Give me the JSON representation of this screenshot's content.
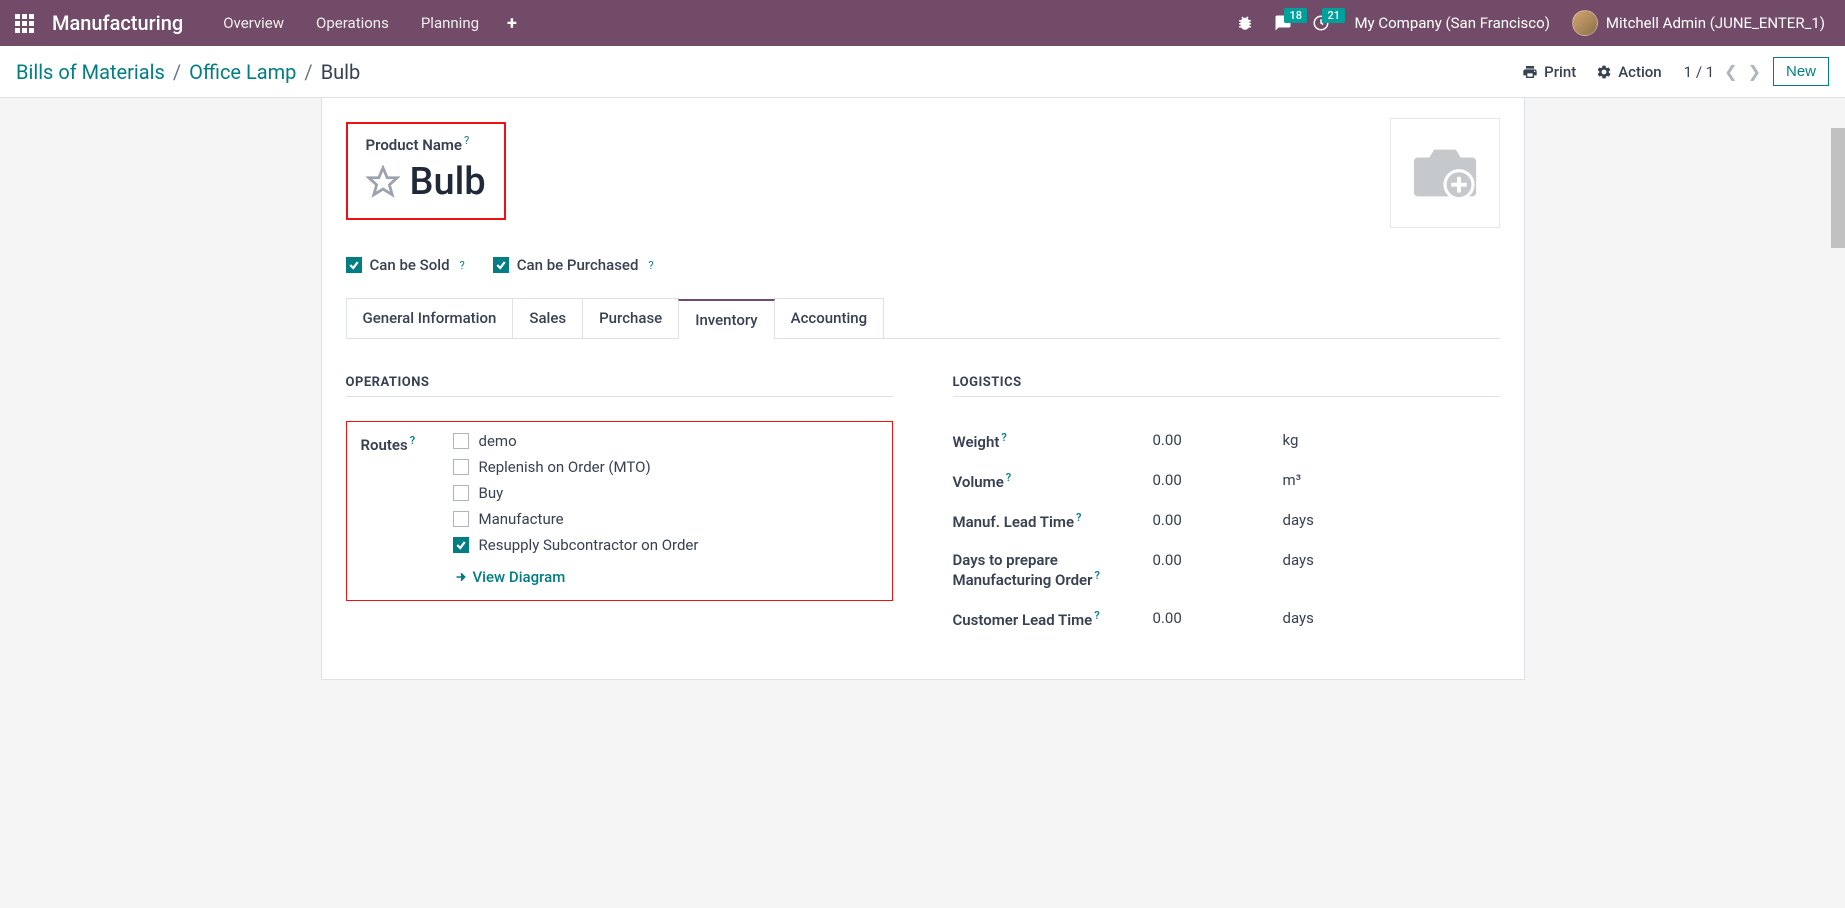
{
  "nav": {
    "brand": "Manufacturing",
    "menu": [
      "Overview",
      "Operations",
      "Planning"
    ],
    "messages_badge": "18",
    "activities_badge": "21",
    "company": "My Company (San Francisco)",
    "user": "Mitchell Admin (JUNE_ENTER_1)"
  },
  "controlbar": {
    "breadcrumb": [
      "Bills of Materials",
      "Office Lamp",
      "Bulb"
    ],
    "print": "Print",
    "action": "Action",
    "pager": "1 / 1",
    "new": "New"
  },
  "form": {
    "title_label": "Product Name",
    "product_name": "Bulb",
    "can_be_sold": "Can be Sold",
    "can_be_purchased": "Can be Purchased",
    "tabs": [
      "General Information",
      "Sales",
      "Purchase",
      "Inventory",
      "Accounting"
    ],
    "active_tab": 3
  },
  "operations": {
    "title": "OPERATIONS",
    "routes_label": "Routes",
    "routes": [
      {
        "label": "demo",
        "checked": false
      },
      {
        "label": "Replenish on Order (MTO)",
        "checked": false
      },
      {
        "label": "Buy",
        "checked": false
      },
      {
        "label": "Manufacture",
        "checked": false
      },
      {
        "label": "Resupply Subcontractor on Order",
        "checked": true
      }
    ],
    "view_diagram": "View Diagram"
  },
  "logistics": {
    "title": "LOGISTICS",
    "rows": [
      {
        "label": "Weight",
        "value": "0.00",
        "unit": "kg",
        "help": true
      },
      {
        "label": "Volume",
        "value": "0.00",
        "unit": "m³",
        "help": true
      },
      {
        "label": "Manuf. Lead Time",
        "value": "0.00",
        "unit": "days",
        "help": true
      },
      {
        "label": "Days to prepare Manufacturing Order",
        "value": "0.00",
        "unit": "days",
        "help": true
      },
      {
        "label": "Customer Lead Time",
        "value": "0.00",
        "unit": "days",
        "help": true
      }
    ]
  }
}
